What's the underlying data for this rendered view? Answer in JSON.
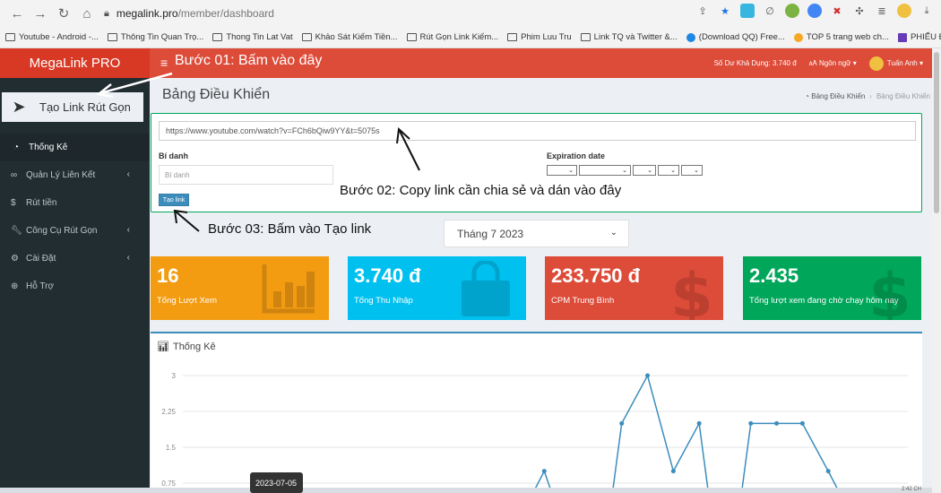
{
  "browser": {
    "url_domain": "megalink.pro",
    "url_path": "/member/dashboard",
    "bookmarks": [
      "Youtube - Android -...",
      "Thông Tin Quan Trọ...",
      "Thong Tin Lat Vat",
      "Khảo Sát Kiếm Tiền...",
      "Rút Gọn Link Kiếm...",
      "Phim Luu Tru",
      "Link TQ và Twitter &...",
      "(Download QQ) Free...",
      "TOP 5 trang web ch...",
      "PHIẾU ĐĂNG KÝ TH..."
    ],
    "more_bookmarks": "»"
  },
  "app": {
    "logo": "MegaLink PRO",
    "balance": "Số Dư Khả Dụng: 3.740 đ",
    "language": "Ngôn ngữ",
    "user": "Tuấn Anh"
  },
  "annotations": {
    "step1": "Bước 01: Bấm vào đây",
    "step2": "Bước 02: Copy link cần chia sẻ và dán vào đây",
    "step3": "Bước 03: Bấm vào Tạo link"
  },
  "sidebar": {
    "cta": "Tạo Link Rút Gọn",
    "items": [
      {
        "label": "Thống Kê",
        "icon": "dashboard-icon"
      },
      {
        "label": "Quản Lý Liên Kết",
        "icon": "link-icon"
      },
      {
        "label": "Rút tiền",
        "icon": "dollar-icon"
      },
      {
        "label": "Công Cụ Rút Gọn",
        "icon": "wrench-icon"
      },
      {
        "label": "Cài Đặt",
        "icon": "gears-icon"
      },
      {
        "label": "Hỗ Trợ",
        "icon": "lifebuoy-icon"
      }
    ]
  },
  "page": {
    "title": "Bảng Điều Khiển",
    "breadcrumb_home": "Bảng Điều Khiển",
    "breadcrumb_current": "Bảng Điều Khiển"
  },
  "form": {
    "url_value": "https://www.youtube.com/watch?v=FCh6bQiw9YY&t=5075s",
    "alias_label": "Bí danh",
    "alias_placeholder": "Bí danh",
    "expiration_label": "Expiration date",
    "submit_label": "Tạo link"
  },
  "month_filter": "Tháng 7 2023",
  "stats": [
    {
      "value": "16",
      "label": "Tổng Lượt Xem",
      "color": "#f39c12"
    },
    {
      "value": "3.740 đ",
      "label": "Tổng Thu Nhập",
      "color": "#00c0ef"
    },
    {
      "value": "233.750 đ",
      "label": "CPM Trung Bình",
      "color": "#dd4b39"
    },
    {
      "value": "2.435",
      "label": "Tổng lượt xem đang chờ chạy hôm nay",
      "color": "#00a65a"
    }
  ],
  "chart_data": {
    "type": "line",
    "title": "Thống Kê",
    "ylim": [
      0.75,
      3
    ],
    "y_ticks": [
      "3",
      "2.25",
      "1.5",
      "0.75"
    ],
    "y_tick_values": [
      3,
      2.25,
      1.5,
      0.75
    ],
    "points": [
      {
        "x": 19,
        "y": 1
      },
      {
        "x": 22,
        "y": 2
      },
      {
        "x": 23,
        "y": 3
      },
      {
        "x": 24,
        "y": 1
      },
      {
        "x": 25,
        "y": 2
      },
      {
        "x": 27,
        "y": 2
      },
      {
        "x": 28,
        "y": 2
      },
      {
        "x": 29,
        "y": 2
      },
      {
        "x": 30,
        "y": 1
      }
    ],
    "x_range": [
      5,
      31
    ],
    "grid": true,
    "tooltip": "2023-07-05"
  },
  "taskbar": {
    "clock": "2:42 CH"
  }
}
